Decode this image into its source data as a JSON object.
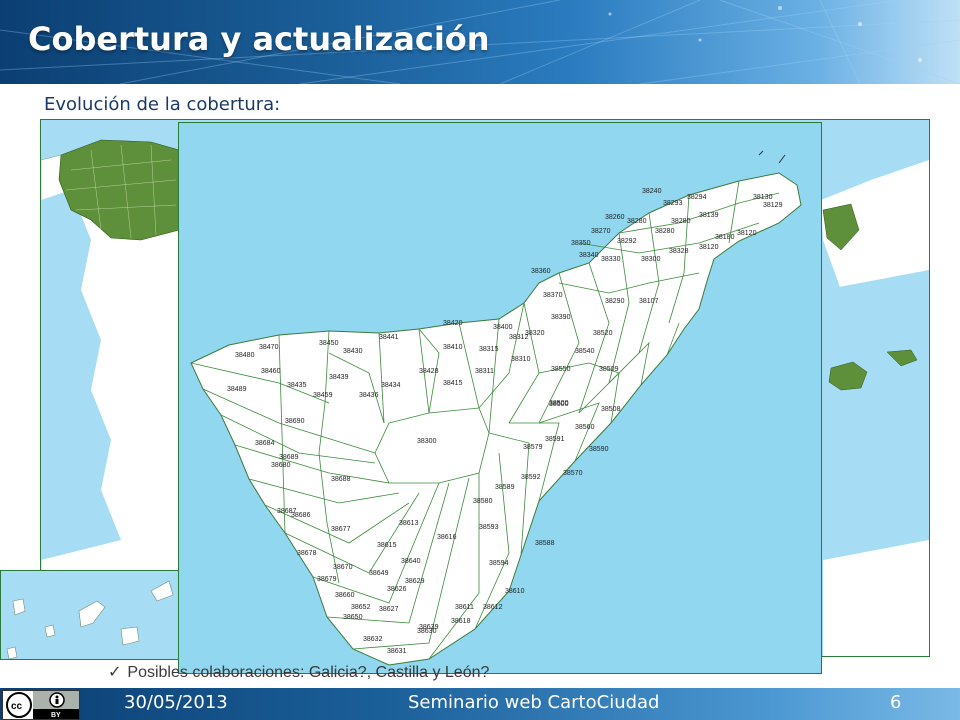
{
  "header": {
    "title": "Cobertura y actualización"
  },
  "content": {
    "subtitle": "Evolución de la cobertura:",
    "bullet": "Posibles colaboraciones: Galicia?, Castilla y León?"
  },
  "footer": {
    "date": "30/05/2013",
    "event": "Seminario web CartoCiudad",
    "page": "6"
  },
  "license_badge": {
    "icons": [
      "cc-icon",
      "by-icon"
    ],
    "text": "BY"
  },
  "tenerife_postal_codes": [
    "38240",
    "38294",
    "38130",
    "38129",
    "38293",
    "38139",
    "38260",
    "38280",
    "38280",
    "38280",
    "38120",
    "38270",
    "38292",
    "38180",
    "38328",
    "38120",
    "38350",
    "38330",
    "38300",
    "38340",
    "38360",
    "38370",
    "38290",
    "38107",
    "38390",
    "38400",
    "38420",
    "38410",
    "38430",
    "38441",
    "38450",
    "38470",
    "38480",
    "38489",
    "38460",
    "38435",
    "38439",
    "38434",
    "38436",
    "38428",
    "38415",
    "38310",
    "38311",
    "38312",
    "38315",
    "38320",
    "38520",
    "38540",
    "38550",
    "38508",
    "38500",
    "38509",
    "38560",
    "38591",
    "38590",
    "38579",
    "38570",
    "38592",
    "38589",
    "38580",
    "38588",
    "38594",
    "38593",
    "38610",
    "38611",
    "38612",
    "38616",
    "38618",
    "38613",
    "38615",
    "38677",
    "38678",
    "38679",
    "38670",
    "38660",
    "38652",
    "38650",
    "38632",
    "38627",
    "38629",
    "38630",
    "38639",
    "38631",
    "38626",
    "38640",
    "38649",
    "38680",
    "38687",
    "38686",
    "38689",
    "38690",
    "38684",
    "38688",
    "38300",
    "38459",
    "38500"
  ]
}
